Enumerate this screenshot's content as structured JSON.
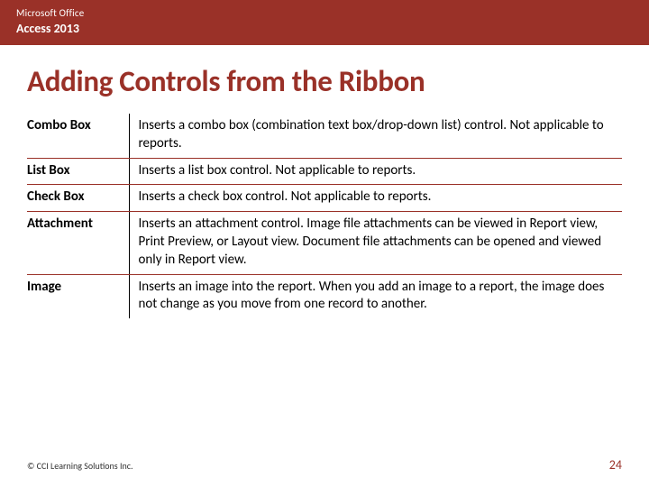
{
  "header": {
    "brand": "Microsoft Office",
    "product": "Access 2013"
  },
  "title": "Adding Controls from the Ribbon",
  "rows": [
    {
      "term": "Combo Box",
      "desc": "Inserts a combo box (combination text box/drop-down list) control. Not applicable to reports."
    },
    {
      "term": "List Box",
      "desc": "Inserts a list box control. Not applicable to reports."
    },
    {
      "term": "Check Box",
      "desc": "Inserts a check box control. Not applicable to reports."
    },
    {
      "term": "Attachment",
      "desc": "Inserts an attachment control. Image file attachments can be viewed in Report view, Print Preview, or Layout view. Document file attachments can be opened and viewed only in Report view."
    },
    {
      "term": "Image",
      "desc": "Inserts an image into the report. When you add an image to a report, the image does not change as you move from one record to another."
    }
  ],
  "footer": {
    "copyright": "© CCI Learning Solutions Inc.",
    "page": "24"
  }
}
